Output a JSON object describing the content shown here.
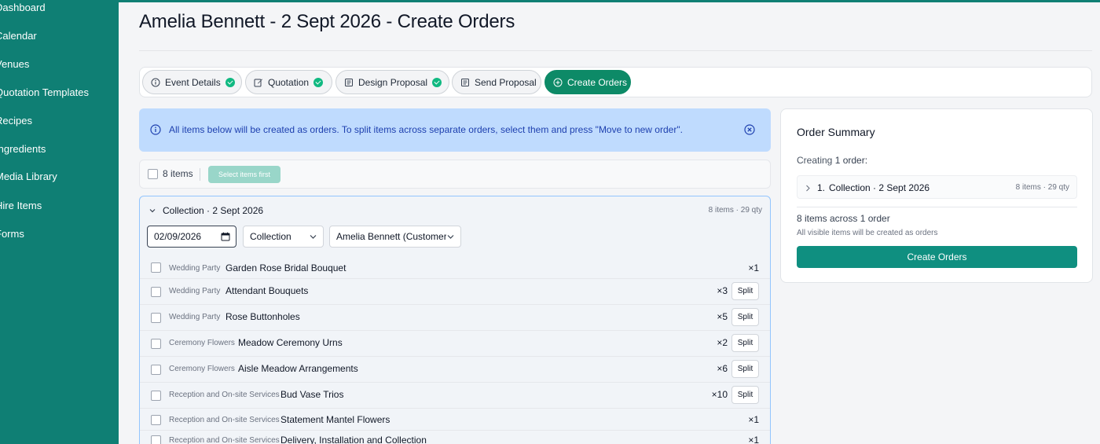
{
  "colors": {
    "brand": "#0f7f74",
    "active_tab": "#0d8a67",
    "check": "#10b981",
    "info_bg": "#bfdbfe",
    "info_text": "#1e40af",
    "group_border": "#93c5fd"
  },
  "sidebar": {
    "items": [
      {
        "label": "Dashboard"
      },
      {
        "label": "Calendar"
      },
      {
        "label": "Venues"
      },
      {
        "label": "Quotation Templates"
      },
      {
        "label": "Recipes"
      },
      {
        "label": "Ingredients"
      },
      {
        "label": "Media Library"
      },
      {
        "label": "Hire Items"
      },
      {
        "label": "Forms"
      }
    ]
  },
  "page": {
    "title": "Amelia Bennett - 2 Sept 2026 - Create Orders"
  },
  "tabs": [
    {
      "label": "Event Details",
      "icon": "info-icon",
      "done": true
    },
    {
      "label": "Quotation",
      "icon": "edit-icon",
      "done": true
    },
    {
      "label": "Design Proposal",
      "icon": "document-icon",
      "done": true
    },
    {
      "label": "Send Proposal",
      "icon": "document-icon",
      "done": false
    },
    {
      "label": "Create Orders",
      "icon": "plus-circle-icon",
      "done": false,
      "active": true
    }
  ],
  "alert": {
    "text": "All items below will be created as orders. To split items across separate orders, select them and press \"Move to new order\"."
  },
  "select_bar": {
    "count_label": "8 items",
    "action_label": "Select items first"
  },
  "group": {
    "title": "Collection · 2 Sept 2026",
    "meta": "8 items · 29 qty",
    "date_value": "02/09/2026",
    "type_value": "Collection",
    "customer_value": "Amelia Bennett (Customer)",
    "split_label": "Split",
    "items": [
      {
        "category": "Wedding Party",
        "name": "Garden Rose Bridal Bouquet",
        "qty": "×1",
        "split": false
      },
      {
        "category": "Wedding Party",
        "name": "Attendant Bouquets",
        "qty": "×3",
        "split": true
      },
      {
        "category": "Wedding Party",
        "name": "Rose Buttonholes",
        "qty": "×5",
        "split": true
      },
      {
        "category": "Ceremony Flowers",
        "name": "Meadow Ceremony Urns",
        "qty": "×2",
        "split": true
      },
      {
        "category": "Ceremony Flowers",
        "name": "Aisle Meadow Arrangements",
        "qty": "×6",
        "split": true
      },
      {
        "category": "Reception and On-site Services",
        "name": "Bud Vase Trios",
        "qty": "×10",
        "split": true
      },
      {
        "category": "Reception and On-site Services",
        "name": "Statement Mantel Flowers",
        "qty": "×1",
        "split": false
      },
      {
        "category": "Reception and On-site Services",
        "name": "Delivery, Installation and Collection",
        "qty": "×1",
        "split": false
      }
    ]
  },
  "summary": {
    "title": "Order Summary",
    "creating_prefix": "Creating",
    "creating_count": "1 order",
    "creating_suffix": ":",
    "order_number": "1.",
    "order_name": "Collection · 2 Sept 2026",
    "order_meta": "8 items · 29 qty",
    "count_text": "8 items across 1 order",
    "note": "All visible items will be created as orders",
    "create_label": "Create Orders"
  }
}
